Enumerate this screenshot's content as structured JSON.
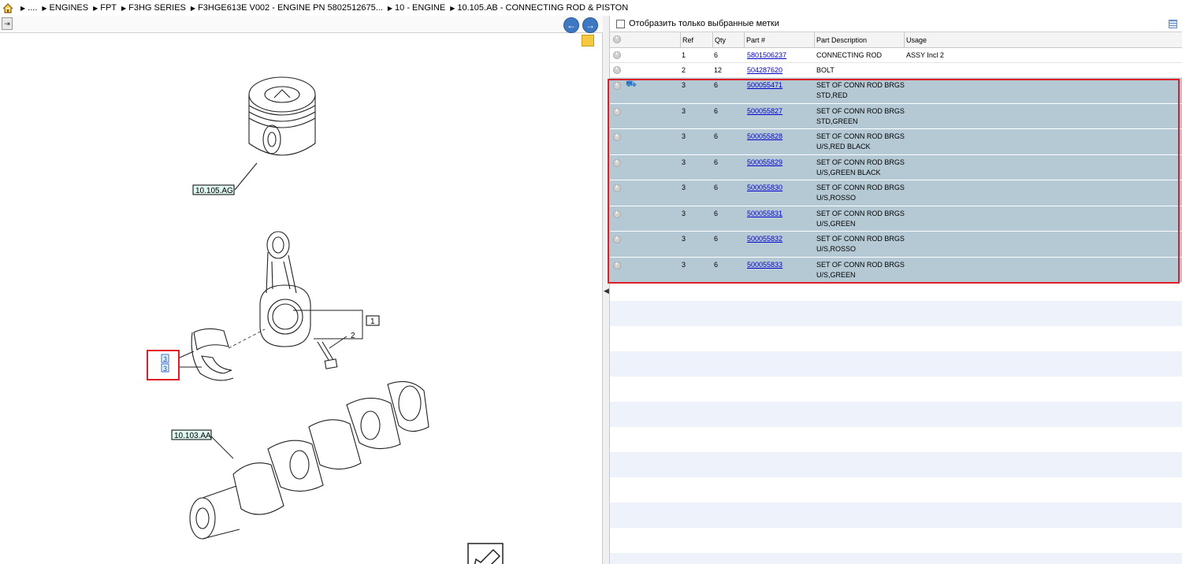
{
  "breadcrumb": [
    {
      "label": "...."
    },
    {
      "label": "ENGINES"
    },
    {
      "label": "FPT"
    },
    {
      "label": "F3HG SERIES"
    },
    {
      "label": "F3HGE613E V002 - ENGINE PN 5802512675..."
    },
    {
      "label": "10 - ENGINE"
    },
    {
      "label": "10.105.AB - CONNECTING ROD & PISTON"
    }
  ],
  "diagram": {
    "callouts": {
      "piston": "10.105.AG",
      "crankshaft": "10.103.AA",
      "rod": "1",
      "bolt": "2",
      "bearing_a": "3",
      "bearing_b": "3"
    }
  },
  "filter": {
    "label": "Отобразить только выбранные метки",
    "checked": false
  },
  "table": {
    "headers": {
      "ref": "Ref",
      "qty": "Qty",
      "part": "Part #",
      "desc": "Part Description",
      "usage": "Usage"
    },
    "rows": [
      {
        "ref": "1",
        "qty": "6",
        "part": "5801506237",
        "desc1": "CONNECTING ROD",
        "desc2": "",
        "usage": "ASSY Incl 2"
      },
      {
        "ref": "2",
        "qty": "12",
        "part": "504287620",
        "desc1": "BOLT",
        "desc2": "",
        "usage": ""
      },
      {
        "ref": "3",
        "qty": "6",
        "part": "500055471",
        "desc1": "SET OF CONN ROD BRGS",
        "desc2": "STD,RED",
        "usage": ""
      },
      {
        "ref": "3",
        "qty": "6",
        "part": "500055827",
        "desc1": "SET OF CONN ROD BRGS",
        "desc2": "STD,GREEN",
        "usage": ""
      },
      {
        "ref": "3",
        "qty": "6",
        "part": "500055828",
        "desc1": "SET OF CONN ROD BRGS",
        "desc2": "U/S,RED BLACK",
        "usage": ""
      },
      {
        "ref": "3",
        "qty": "6",
        "part": "500055829",
        "desc1": "SET OF CONN ROD BRGS",
        "desc2": "U/S,GREEN BLACK",
        "usage": ""
      },
      {
        "ref": "3",
        "qty": "6",
        "part": "500055830",
        "desc1": "SET OF CONN ROD BRGS",
        "desc2": "U/S,ROSSO",
        "usage": ""
      },
      {
        "ref": "3",
        "qty": "6",
        "part": "500055831",
        "desc1": "SET OF CONN ROD BRGS",
        "desc2": "U/S,GREEN",
        "usage": ""
      },
      {
        "ref": "3",
        "qty": "6",
        "part": "500055832",
        "desc1": "SET OF CONN ROD BRGS",
        "desc2": "U/S,ROSSO",
        "usage": ""
      },
      {
        "ref": "3",
        "qty": "6",
        "part": "500055833",
        "desc1": "SET OF CONN ROD BRGS",
        "desc2": "U/S,GREEN",
        "usage": ""
      }
    ]
  },
  "colors": {
    "highlight": "#e01e2a",
    "selected_row": "#b5c9d5",
    "link": "#0000cc",
    "nav": "#3f78c2"
  },
  "icons": [
    "home-icon",
    "exit-icon",
    "back-arrow-icon",
    "forward-arrow-icon",
    "notes-icon",
    "grid-view-icon",
    "add-row-icon",
    "cart-icon",
    "collapse-arrow-icon"
  ]
}
